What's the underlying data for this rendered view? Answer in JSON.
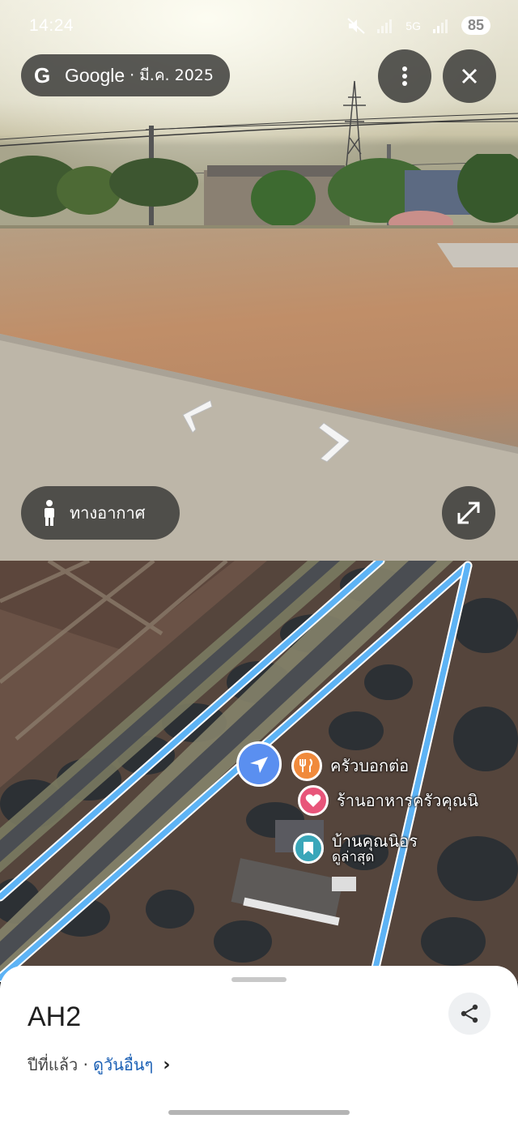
{
  "status_bar": {
    "time": "14:24",
    "network": "5G",
    "battery": "85"
  },
  "street_view": {
    "logo_letter": "G",
    "brand": "Google",
    "date": "· มี.ค. 2025",
    "aerial_label": "ทางอากาศ",
    "icons": {
      "more": "more-vert-icon",
      "close": "close-icon",
      "expand": "expand-icon",
      "person": "person-icon",
      "nav_left": "chevron-left-icon",
      "nav_right": "chevron-right-icon"
    }
  },
  "map": {
    "pois": [
      {
        "name": "ครัวบอกต่อ",
        "icon": "restaurant-icon",
        "color": "#f08a3c"
      },
      {
        "name": "ร้านอาหารครัวคุณนิ",
        "icon": "heart-icon",
        "color": "#e8557a"
      },
      {
        "name": "บ้านคุณนิอร",
        "sub": "ดูล่าสุด",
        "icon": "bookmark-icon",
        "color": "#3aa6b9"
      }
    ],
    "route_color": "#5db3f5"
  },
  "sheet": {
    "title": "AH2",
    "subtitle": "ปีที่แล้ว ·",
    "link": "ดูวันอื่นๆ",
    "chevron": "›"
  }
}
